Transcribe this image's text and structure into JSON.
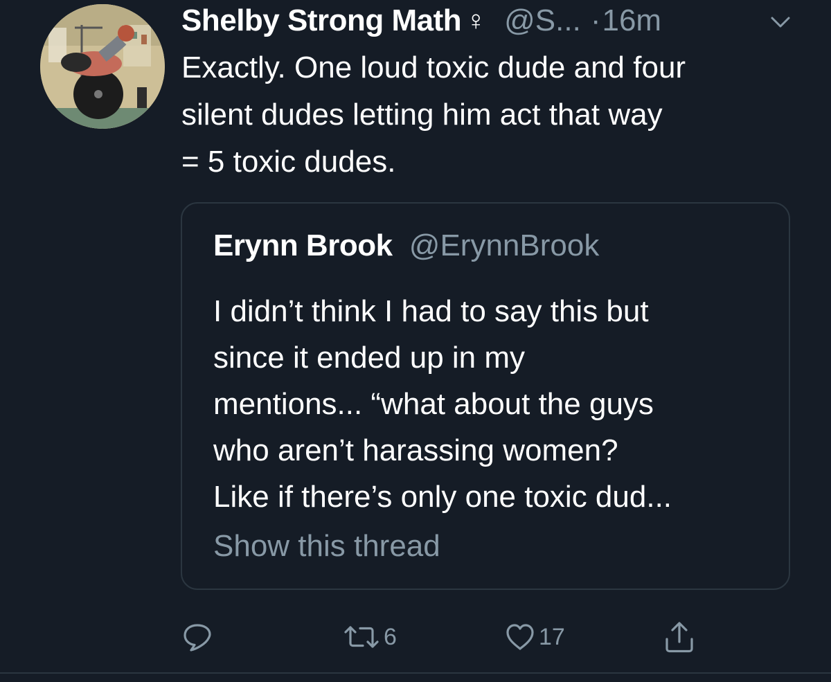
{
  "tweet": {
    "display_name": "Shelby Strong Math",
    "name_symbol": "♀",
    "handle": "@S...",
    "separator": "·",
    "time": "16m",
    "text_lines": [
      "Exactly. One loud toxic dude and four",
      "silent dudes letting him act that way",
      "= 5 toxic dudes."
    ],
    "menu_icon": "chevron-down-icon"
  },
  "quote": {
    "display_name": "Erynn Brook",
    "handle": "@ErynnBrook",
    "text_lines": [
      "I didn’t think I had to say this but",
      "since it ended up in my",
      "mentions... “what about the guys",
      "who aren’t harassing women?",
      "Like if there’s only one toxic dud..."
    ],
    "show_thread": "Show this thread"
  },
  "actions": {
    "reply_icon": "reply-icon",
    "retweet_icon": "retweet-icon",
    "retweet_count": "6",
    "like_icon": "heart-icon",
    "like_count": "17",
    "share_icon": "share-icon"
  },
  "colors": {
    "background": "#151c26",
    "primary_text": "#ffffff",
    "secondary_text": "#8899a6",
    "border": "#2b3640"
  }
}
